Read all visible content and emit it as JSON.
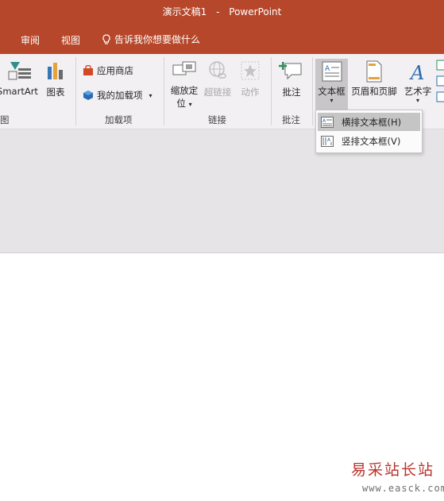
{
  "window": {
    "doc_title": "演示文稿1",
    "separator": "-",
    "app_name": "PowerPoint"
  },
  "menu": {
    "tabs": [
      {
        "label": "审阅"
      },
      {
        "label": "视图"
      }
    ],
    "tell_me": "告诉我你想要做什么"
  },
  "ribbon": {
    "illustrations": {
      "smartart": "SmartArt",
      "chart": "图表",
      "group_label": "图"
    },
    "addins": {
      "store": "应用商店",
      "my_addins": "我的加载项",
      "group_label": "加载项"
    },
    "links": {
      "zoom_line1": "缩放定",
      "zoom_line2": "位",
      "hyperlink": "超链接",
      "action": "动作",
      "group_label": "链接"
    },
    "comments": {
      "comment": "批注",
      "group_label": "批注"
    },
    "text": {
      "textbox": "文本框",
      "header_footer": "页眉和页脚",
      "wordart": "艺术字"
    }
  },
  "textbox_menu": {
    "items": [
      {
        "label": "横排文本框(H)",
        "state": "hover"
      },
      {
        "label": "竖排文本框(V)",
        "state": "normal"
      }
    ]
  },
  "watermark": {
    "text": "易采站长站",
    "url": "www.easck.com"
  },
  "colors": {
    "accent": "#b7472a",
    "ribbon_bg": "#f2f0f2",
    "canvas_bg": "#e6e4e6",
    "hover": "#c5c5c5",
    "watermark": "#b8342d"
  }
}
